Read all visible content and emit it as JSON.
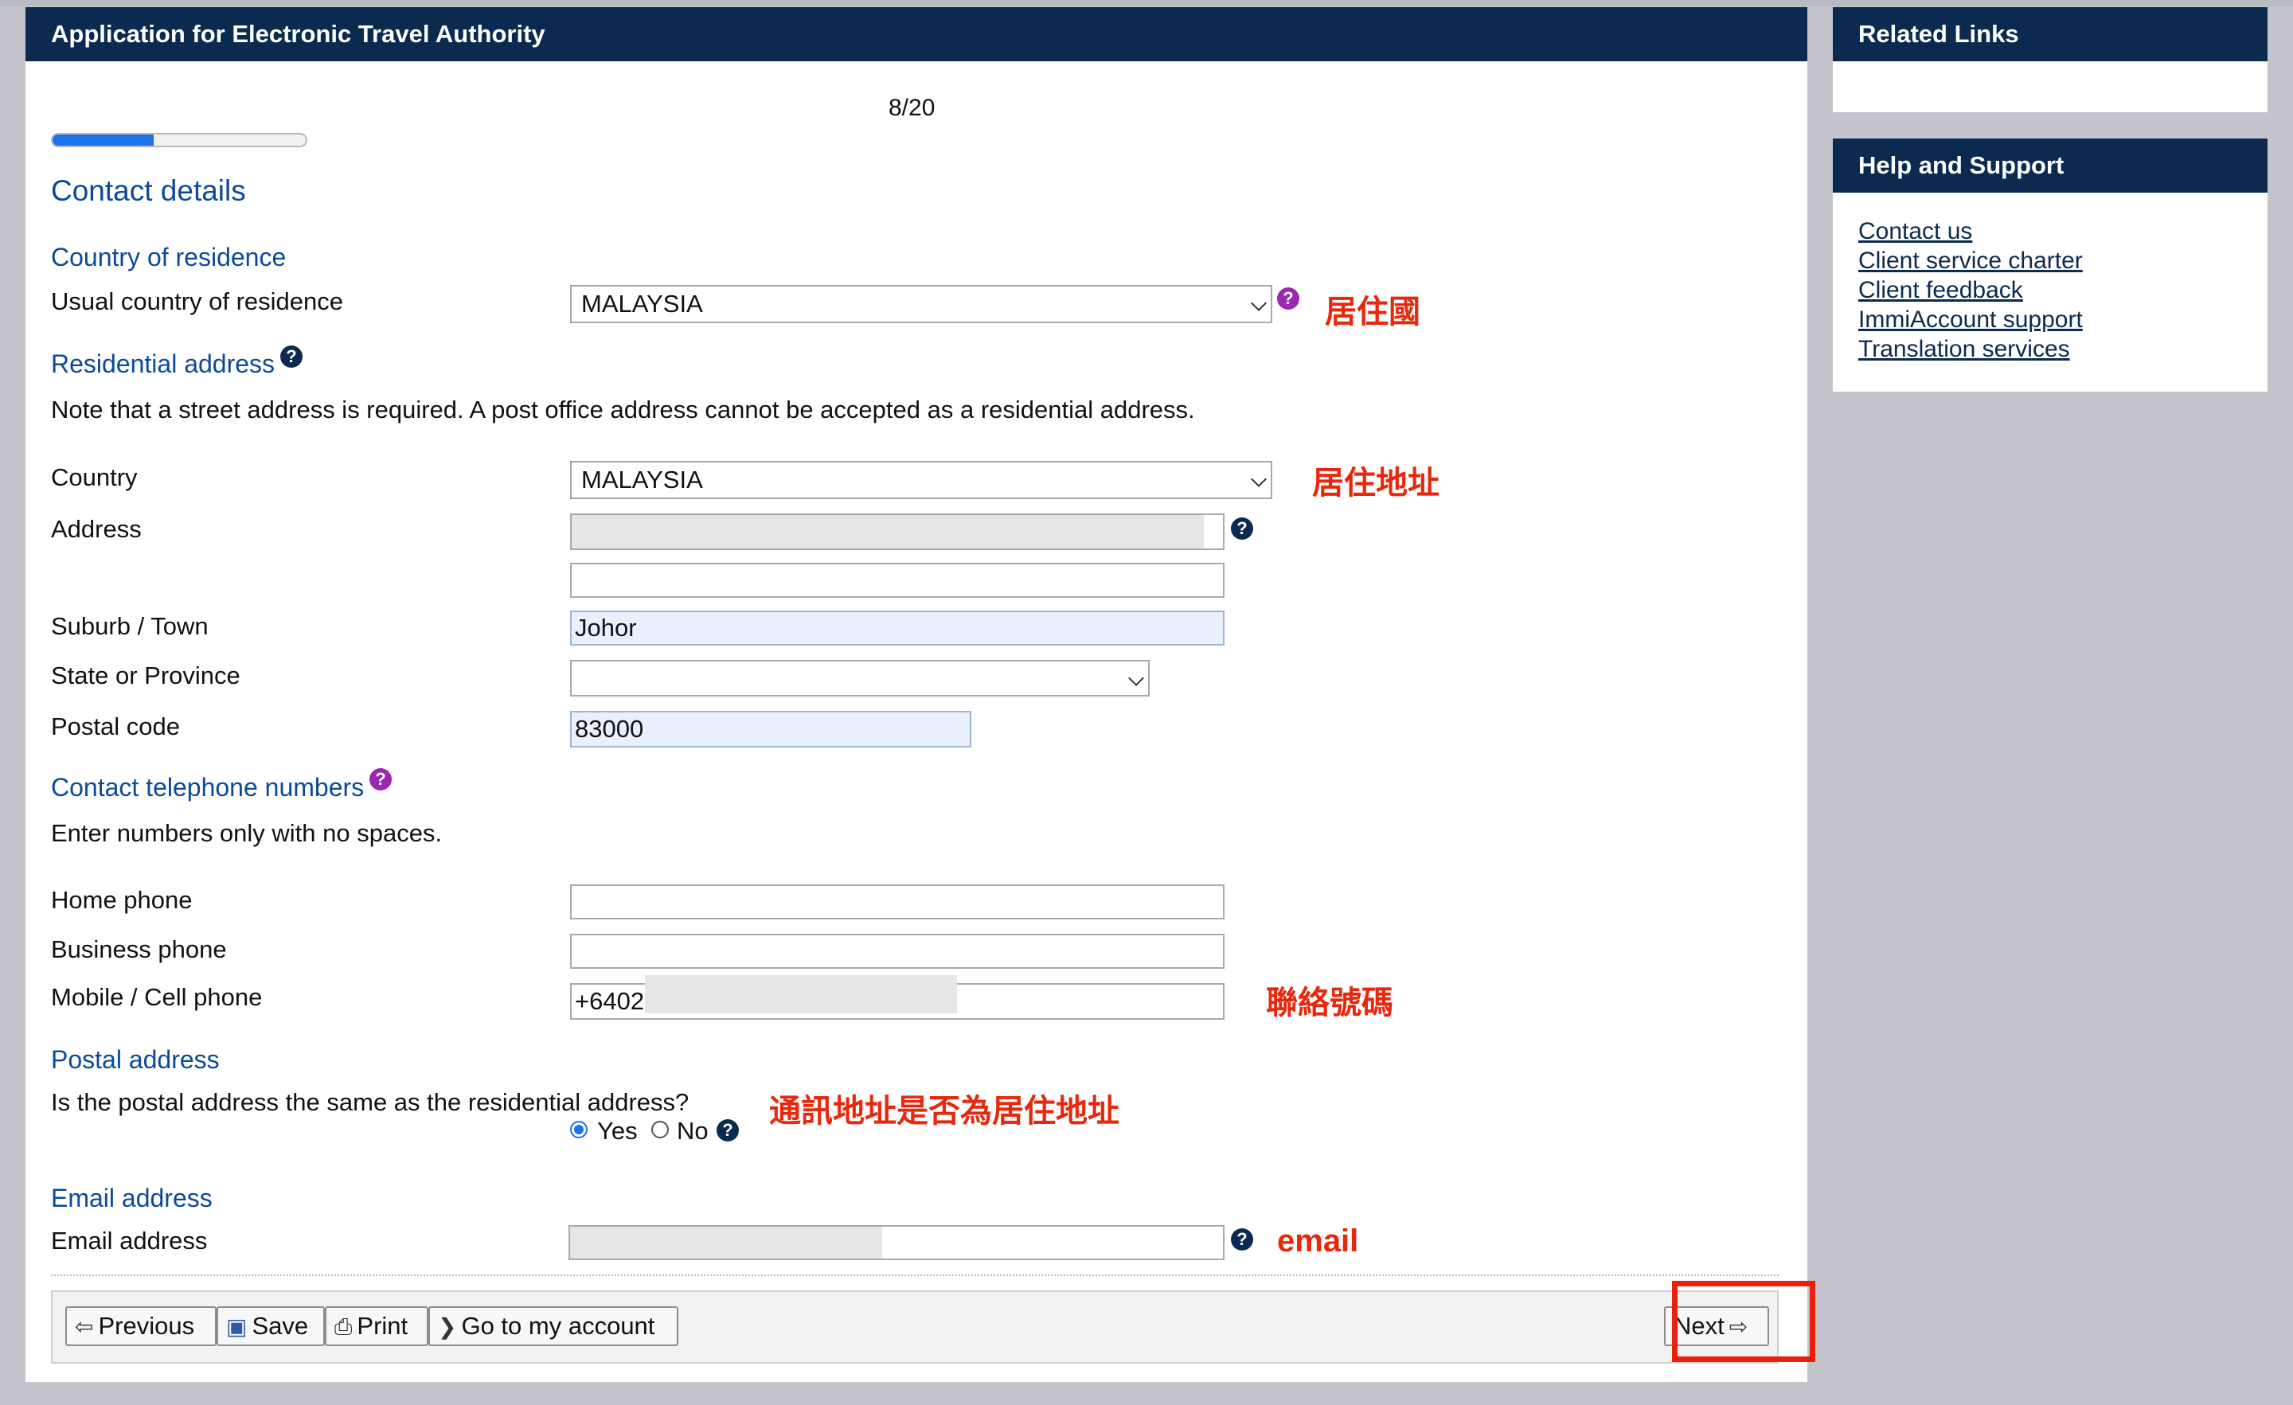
{
  "app": {
    "header_title": "Application for Electronic Travel Authority",
    "progress_label": "8/20",
    "progress_fraction": 0.4
  },
  "form": {
    "page_title": "Contact details",
    "country_residence": {
      "section_title": "Country of residence",
      "usual_country_label": "Usual country of residence",
      "usual_country_value": "MALAYSIA"
    },
    "residential": {
      "section_title": "Residential address",
      "note": "Note that a street address is required. A post office address cannot be accepted as a residential address.",
      "country_label": "Country",
      "country_value": "MALAYSIA",
      "address_label": "Address",
      "address_line1_value": "",
      "address_line2_value": "",
      "suburb_label": "Suburb / Town",
      "suburb_value": "Johor",
      "state_label": "State or Province",
      "state_value": "",
      "postal_label": "Postal code",
      "postal_value": "83000"
    },
    "phones": {
      "section_title": "Contact telephone numbers",
      "note": "Enter numbers only with no spaces.",
      "home_label": "Home phone",
      "home_value": "",
      "business_label": "Business phone",
      "business_value": "",
      "mobile_label": "Mobile / Cell phone",
      "mobile_value": "+6402"
    },
    "postal": {
      "section_title": "Postal address",
      "question": "Is the postal address the same as the residential address?",
      "yes_label": "Yes",
      "no_label": "No",
      "selected": "Yes"
    },
    "email": {
      "section_title": "Email address",
      "label": "Email address",
      "value": ""
    }
  },
  "annotations": {
    "country_of_residence": "居住國",
    "residential_address": "居住地址",
    "contact_number": "聯絡號碼",
    "postal_same": "通訊地址是否為居住地址",
    "email": "email"
  },
  "footer": {
    "previous_label": "Previous",
    "save_label": "Save",
    "print_label": "Print",
    "account_label": "Go to my account",
    "next_label": "Next"
  },
  "sidebar": {
    "related_links_title": "Related Links",
    "help_title": "Help and Support",
    "help_links": [
      "Contact us",
      "Client service charter",
      "Client feedback",
      "ImmiAccount support",
      "Translation services"
    ]
  },
  "colors": {
    "header_bg": "#0a2a4f",
    "section_blue": "#0b4a9a",
    "annotation_red": "#e8280c",
    "progress_blue": "#1a73e8",
    "autofill_bg": "#e8f0fe"
  },
  "icons": {
    "help": "question-circle-icon",
    "previous": "arrow-left-icon",
    "save": "floppy-disk-icon",
    "print": "printer-icon",
    "account": "chevron-right-icon",
    "next": "arrow-right-icon",
    "select": "chevron-down-icon"
  }
}
